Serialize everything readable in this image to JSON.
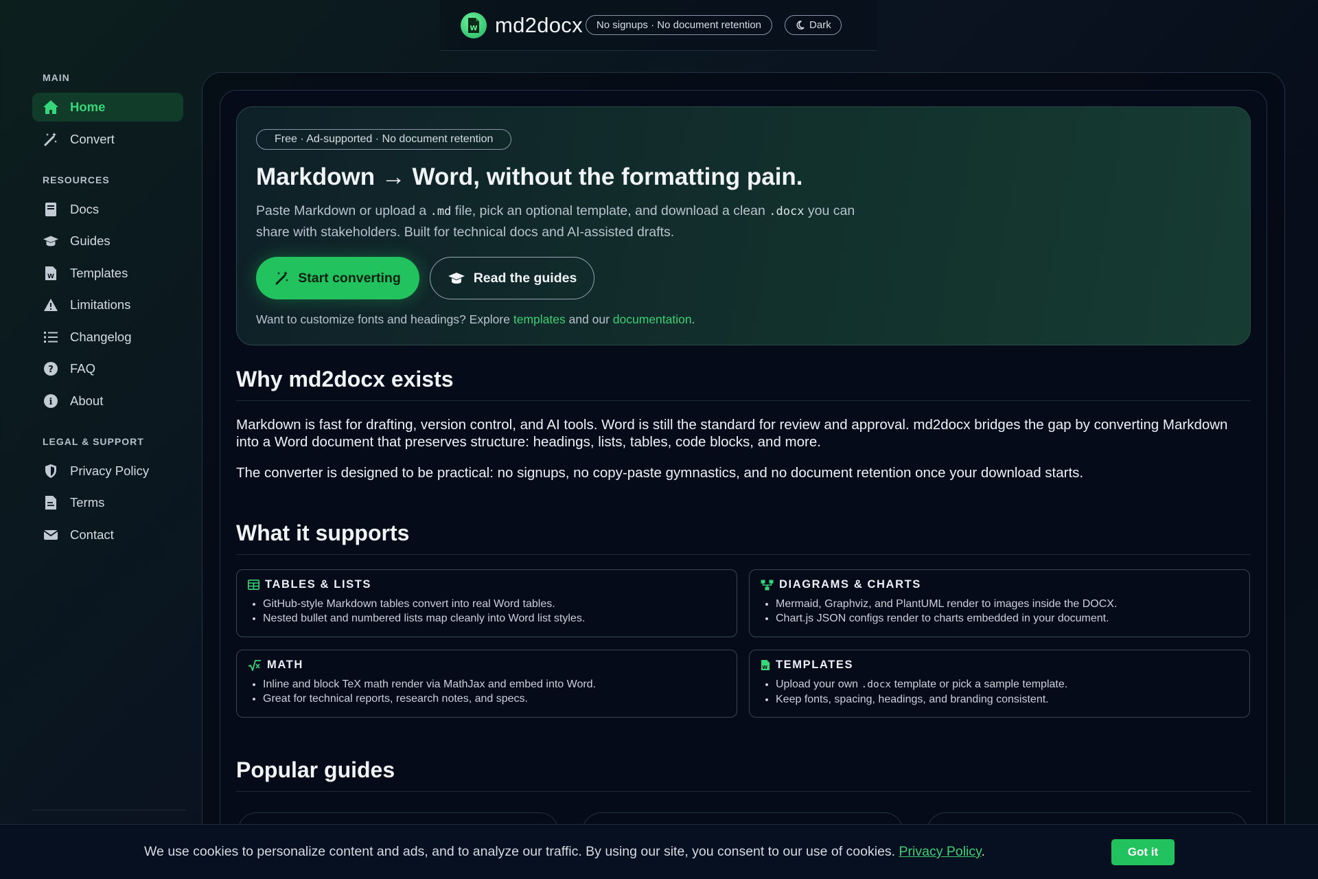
{
  "header": {
    "brand": "md2docx",
    "badge": "No signups · No document retention",
    "theme_toggle": "Dark"
  },
  "sidebar": {
    "sections": [
      {
        "title": "MAIN",
        "items": [
          {
            "label": "Home",
            "icon": "home-icon",
            "active": true
          },
          {
            "label": "Convert",
            "icon": "magic-wand-icon"
          }
        ]
      },
      {
        "title": "RESOURCES",
        "items": [
          {
            "label": "Docs",
            "icon": "book-icon"
          },
          {
            "label": "Guides",
            "icon": "graduation-cap-icon"
          },
          {
            "label": "Templates",
            "icon": "word-file-icon"
          },
          {
            "label": "Limitations",
            "icon": "warning-icon"
          },
          {
            "label": "Changelog",
            "icon": "list-icon"
          },
          {
            "label": "FAQ",
            "icon": "question-icon"
          },
          {
            "label": "About",
            "icon": "info-icon"
          }
        ]
      },
      {
        "title": "LEGAL & SUPPORT",
        "items": [
          {
            "label": "Privacy Policy",
            "icon": "shield-icon"
          },
          {
            "label": "Terms",
            "icon": "document-icon"
          },
          {
            "label": "Contact",
            "icon": "envelope-icon"
          }
        ]
      }
    ]
  },
  "hero": {
    "badge": "Free · Ad-supported · No document retention",
    "title": "Markdown → Word, without the formatting pain.",
    "desc_1": "Paste Markdown or upload a ",
    "desc_code_1": ".md",
    "desc_2": " file, pick an optional template, and download a clean ",
    "desc_code_2": ".docx",
    "desc_3": " you can share with stakeholders. Built for technical docs and AI-assisted drafts.",
    "primary_button": "Start converting",
    "secondary_button": "Read the guides",
    "note_1": "Want to customize fonts and headings? Explore ",
    "note_link_1": "templates",
    "note_2": " and our ",
    "note_link_2": "documentation",
    "note_3": "."
  },
  "why": {
    "heading": "Why md2docx exists",
    "p1": "Markdown is fast for drafting, version control, and AI tools. Word is still the standard for review and approval. md2docx bridges the gap by converting Markdown into a Word document that preserves structure: headings, lists, tables, code blocks, and more.",
    "p2": "The converter is designed to be practical: no signups, no copy-paste gymnastics, and no document retention once your download starts."
  },
  "supports": {
    "heading": "What it supports",
    "features": [
      {
        "title": "TABLES & LISTS",
        "icon": "table-icon",
        "items": [
          "GitHub-style Markdown tables convert into real Word tables.",
          "Nested bullet and numbered lists map cleanly into Word list styles."
        ]
      },
      {
        "title": "DIAGRAMS & CHARTS",
        "icon": "diagram-icon",
        "items": [
          "Mermaid, Graphviz, and PlantUML render to images inside the DOCX.",
          "Chart.js JSON configs render to charts embedded in your document."
        ]
      },
      {
        "title": "MATH",
        "icon": "square-root-icon",
        "items": [
          "Inline and block TeX math render via MathJax and embed into Word.",
          "Great for technical reports, research notes, and specs."
        ]
      },
      {
        "title": "TEMPLATES",
        "icon": "word-file-icon",
        "item1_pre": "Upload your own ",
        "item1_code": ".docx",
        "item1_post": " template or pick a sample template.",
        "item2": "Keep fonts, spacing, headings, and branding consistent."
      }
    ]
  },
  "guides": {
    "heading": "Popular guides"
  },
  "cookie": {
    "text": "We use cookies to personalize content and ads, and to analyze our traffic. By using our site, you consent to our use of cookies. ",
    "link": "Privacy Policy",
    "suffix": ".",
    "button": "Got it"
  },
  "colors": {
    "accent": "#22c35e",
    "link": "#3ccf74",
    "background": "#050b18"
  }
}
